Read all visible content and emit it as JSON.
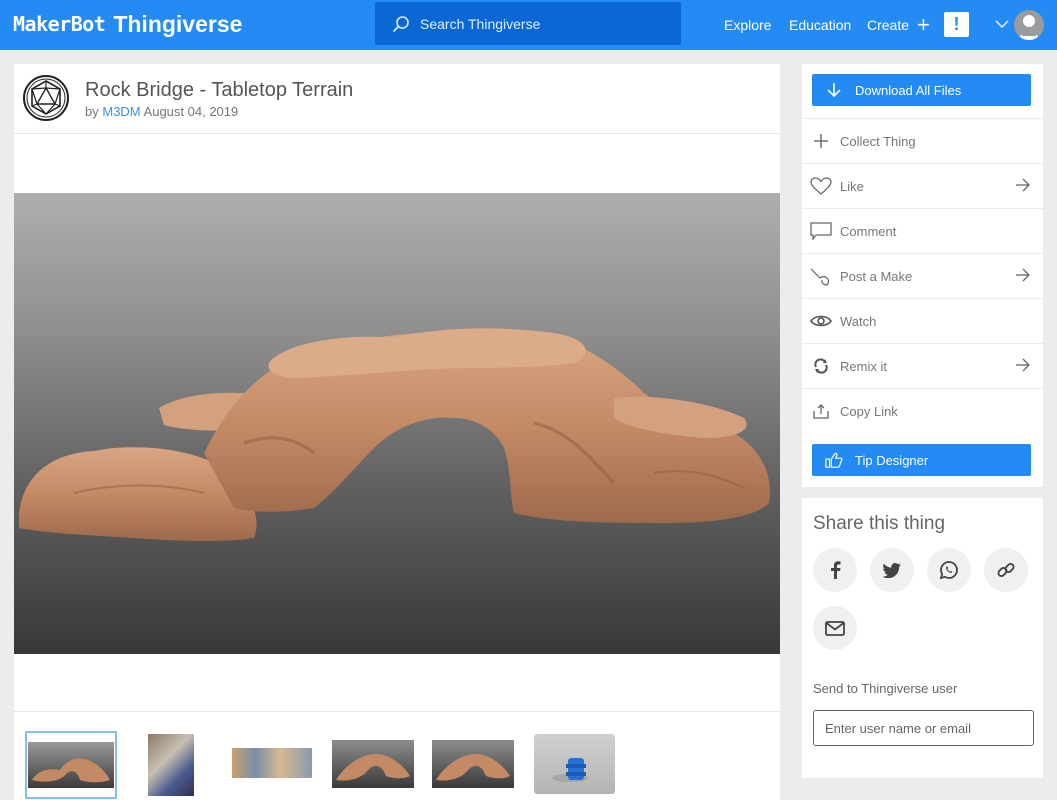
{
  "topbar": {
    "logo_maker": "MakerBot",
    "logo_thing": "Thingiverse",
    "search_placeholder": "Search Thingiverse",
    "nav": [
      "Explore",
      "Education",
      "Create"
    ],
    "alert_label": "!",
    "brand_color": "#248bf5"
  },
  "thing": {
    "title": "Rock Bridge - Tabletop Terrain",
    "by_prefix": "by",
    "author": "M3DM",
    "date": "August 04, 2019"
  },
  "gallery": {
    "thumbnails": [
      {
        "label": "rock bridge render",
        "active": true
      },
      {
        "label": "printed photo",
        "active": false
      },
      {
        "label": "layout sheet",
        "active": false
      },
      {
        "label": "rock bridge side view",
        "active": false
      },
      {
        "label": "rock bridge alt view",
        "active": false
      },
      {
        "label": "blue print preview",
        "active": false
      }
    ]
  },
  "sidebar": {
    "download_label": "Download All Files",
    "actions": [
      {
        "label": "Collect Thing",
        "icon": "plus-icon",
        "arrow": false
      },
      {
        "label": "Like",
        "icon": "heart-icon",
        "arrow": true
      },
      {
        "label": "Comment",
        "icon": "comment-icon",
        "arrow": false
      },
      {
        "label": "Post a Make",
        "icon": "make-icon",
        "arrow": true
      },
      {
        "label": "Watch",
        "icon": "eye-icon",
        "arrow": false
      },
      {
        "label": "Remix it",
        "icon": "remix-icon",
        "arrow": true
      },
      {
        "label": "Copy Link",
        "icon": "share-upload-icon",
        "arrow": false
      }
    ],
    "tip_label": "Tip Designer"
  },
  "share": {
    "title": "Share this thing",
    "networks": [
      "facebook",
      "twitter",
      "whatsapp",
      "link",
      "email"
    ],
    "send_label": "Send to Thingiverse user",
    "send_placeholder": "Enter user name or email",
    "send_value": ""
  }
}
